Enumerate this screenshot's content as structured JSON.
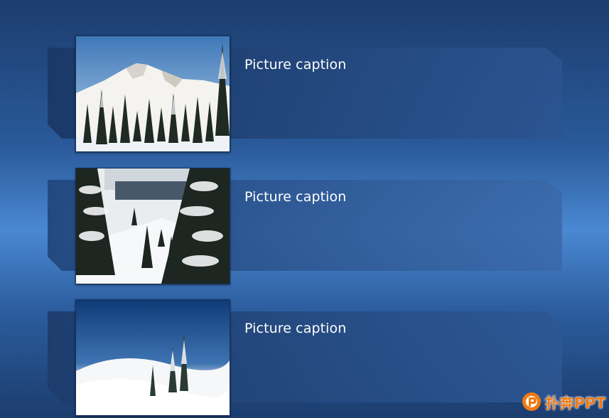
{
  "slides": {
    "items": [
      {
        "caption": "Picture caption",
        "photo": "snowy-mountain-photo"
      },
      {
        "caption": "Picture caption",
        "photo": "snowy-forest-photo"
      },
      {
        "caption": "Picture caption",
        "photo": "snowy-hill-trees-photo"
      }
    ]
  },
  "logo": {
    "text": "扑奔PPT",
    "icon": "logo-icon"
  },
  "colors": {
    "background_top": "#1c3d6e",
    "background_mid": "#4a88d2",
    "banner_fill": "#1e3f70",
    "caption_text": "#ffffff",
    "logo_orange": "#f07a12"
  }
}
